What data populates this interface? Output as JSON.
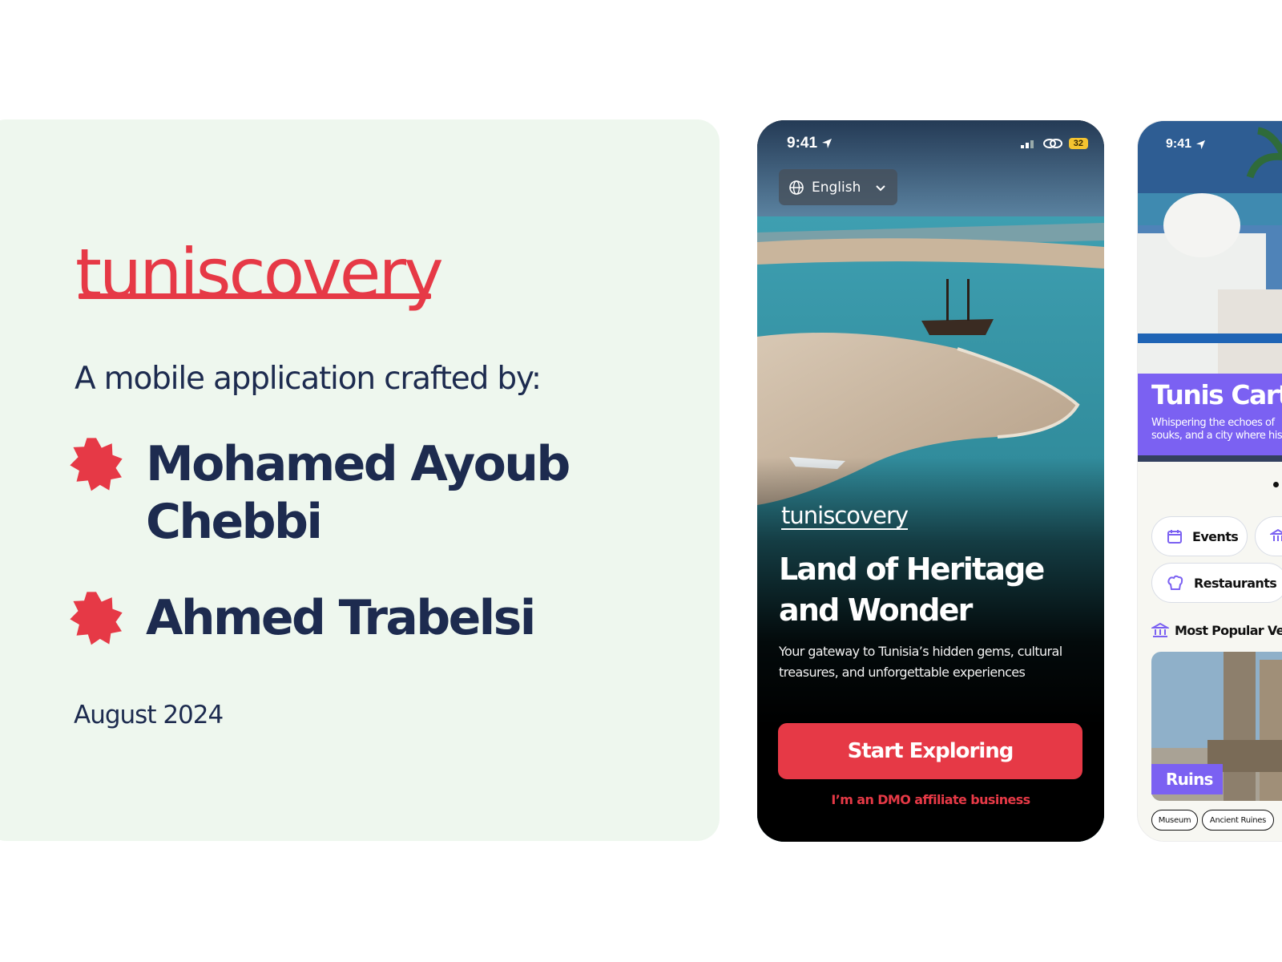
{
  "info_card": {
    "brand": "tuniscovery",
    "crafted_by": "A mobile application crafted by:",
    "authors": [
      "Mohamed Ayoub Chebbi",
      "Ahmed Trabelsi"
    ],
    "date": "August 2024"
  },
  "welcome_screen": {
    "status_time": "9:41",
    "battery": "32",
    "language": "English",
    "logo": "tuniscovery",
    "title": "Land of Heritage and Wonder",
    "subtitle": "Your gateway to Tunisia’s hidden gems, cultural treasures, and unforgettable experiences",
    "cta": "Start Exploring",
    "secondary_link": "I’m an DMO affiliate business"
  },
  "home_screen": {
    "status_time": "9:41",
    "banner_title": "Tunis Carth",
    "banner_subtitle_line1": "Whispering the echoes of",
    "banner_subtitle_line2": "souks, and a city where his",
    "chips": [
      "Events",
      "Restaurants"
    ],
    "section_title": "Most Popular Ver",
    "venue_category": "Ruins",
    "venue_tags": [
      "Museum",
      "Ancient Ruines"
    ]
  },
  "colors": {
    "brand_red": "#e63946",
    "navy": "#1d2b4f",
    "accent_purple": "#7b61f2",
    "card_bg": "#eef7ee"
  },
  "icons": [
    "star-burst-icon",
    "location-arrow-icon",
    "globe-icon",
    "chevron-down-icon",
    "signal-icon",
    "link-icon",
    "calendar-icon",
    "landmark-icon",
    "chef-hat-icon"
  ]
}
